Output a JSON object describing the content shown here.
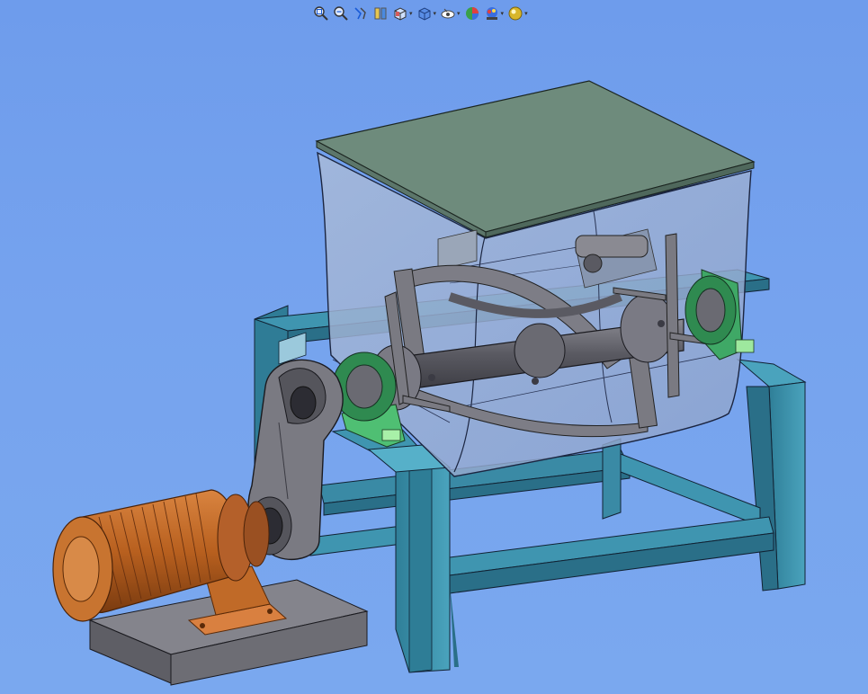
{
  "app": {
    "type": "3D CAD model viewport",
    "background_color": "#73a0ee"
  },
  "toolbar": {
    "buttons": [
      {
        "name": "zoom-to-fit-icon",
        "has_dropdown": false
      },
      {
        "name": "zoom-to-area-icon",
        "has_dropdown": false
      },
      {
        "name": "previous-view-icon",
        "has_dropdown": false
      },
      {
        "name": "section-view-icon",
        "has_dropdown": false
      },
      {
        "name": "view-orientation-icon",
        "has_dropdown": true
      },
      {
        "name": "display-style-icon",
        "has_dropdown": true
      },
      {
        "name": "hide-show-items-icon",
        "has_dropdown": true
      },
      {
        "name": "edit-appearance-icon",
        "has_dropdown": false
      },
      {
        "name": "apply-scene-icon",
        "has_dropdown": true
      },
      {
        "name": "view-settings-icon",
        "has_dropdown": true
      }
    ],
    "dropdown_glyph": "▾"
  },
  "model": {
    "parts": [
      "mixing-tank",
      "tank-lid",
      "frame",
      "mixing-shaft",
      "ribbon-agitator",
      "pillow-block-bearing-left",
      "pillow-block-bearing-right",
      "drive-pulley",
      "belt-guard",
      "electric-motor",
      "motor-mount",
      "motor-base-plate"
    ],
    "colors": {
      "frame": "#3d8fa8",
      "lid": "#6e8b7c",
      "tank": "#9fb1d6",
      "shaft": "#6f6f77",
      "bearing": "#4fbf73",
      "motor": "#c06a28",
      "guard": "#7a7a82",
      "base": "#75757c"
    }
  }
}
